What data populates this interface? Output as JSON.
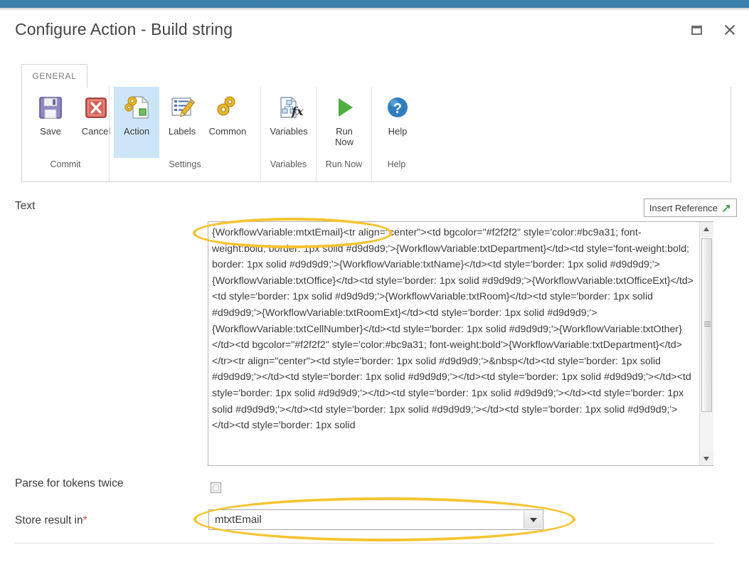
{
  "window": {
    "title": "Configure Action - Build string",
    "accent_color": "#3d7fac",
    "restore_icon": "restore-window-icon",
    "close_icon": "close-icon"
  },
  "ribbon": {
    "tabs": [
      {
        "label": "GENERAL",
        "active": true
      }
    ],
    "groups": [
      {
        "label": "Commit",
        "buttons": [
          {
            "label": "Save",
            "icon": "save-floppy-disk-icon",
            "selected": false
          },
          {
            "label": "Cancel",
            "icon": "cancel-red-x-icon",
            "selected": false
          }
        ]
      },
      {
        "label": "Settings",
        "buttons": [
          {
            "label": "Action",
            "icon": "action-gears-document-icon",
            "selected": true
          },
          {
            "label": "Labels",
            "icon": "labels-list-pencil-icon",
            "selected": false
          },
          {
            "label": "Common",
            "icon": "common-gears-icon",
            "selected": false
          }
        ]
      },
      {
        "label": "Variables",
        "buttons": [
          {
            "label": "Variables",
            "icon": "variables-fx-document-icon",
            "selected": false
          }
        ]
      },
      {
        "label": "Run Now",
        "buttons": [
          {
            "label": "Run\nNow",
            "icon": "run-now-green-play-icon",
            "selected": false
          }
        ]
      },
      {
        "label": "Help",
        "buttons": [
          {
            "label": "Help",
            "icon": "help-question-circle-icon",
            "selected": false
          }
        ]
      }
    ]
  },
  "form": {
    "text_field": {
      "label": "Text",
      "insert_reference_label": "Insert Reference",
      "insert_reference_icon": "insert-reference-arrow-icon",
      "value": "{WorkflowVariable:mtxtEmail}<tr align=\"center\"><td bgcolor=\"#f2f2f2\" style='color:#bc9a31; font-weight:bold; border: 1px solid #d9d9d9;'>{WorkflowVariable:txtDepartment}</td><td style='font-weight:bold; border: 1px solid #d9d9d9;'>{WorkflowVariable:txtName}</td><td style='border: 1px solid #d9d9d9;'>{WorkflowVariable:txtOffice}</td><td style='border: 1px solid #d9d9d9;'>{WorkflowVariable:txtOfficeExt}</td><td style='border: 1px solid #d9d9d9;'>{WorkflowVariable:txtRoom}</td><td style='border: 1px solid #d9d9d9;'>{WorkflowVariable:txtRoomExt}</td><td style='border: 1px solid #d9d9d9;'>{WorkflowVariable:txtCellNumber}</td><td style='border: 1px solid #d9d9d9;'>{WorkflowVariable:txtOther}</td><td bgcolor=\"#f2f2f2\" style='color:#bc9a31; font-weight:bold'>{WorkflowVariable:txtDepartment}</td></tr><tr align=\"center\"><td style='border: 1px solid #d9d9d9;'>&nbsp</td><td style='border: 1px solid #d9d9d9;'></td><td style='border: 1px solid #d9d9d9;'></td><td style='border: 1px solid #d9d9d9;'></td><td style='border: 1px solid #d9d9d9;'></td><td style='border: 1px solid #d9d9d9;'></td><td style='border: 1px solid #d9d9d9;'></td><td style='border: 1px solid #d9d9d9;'></td><td style='border: 1px solid #d9d9d9;'></td><td style='border: 1px solid"
    },
    "parse_twice": {
      "label": "Parse for tokens twice",
      "checked": false
    },
    "store_result": {
      "label": "Store result in",
      "required_marker": "*",
      "value": "mtxtEmail",
      "options": [
        "mtxtEmail"
      ]
    }
  },
  "annotations": {
    "highlight_color": "#f5c431",
    "shapes": [
      {
        "name": "text-first-line-highlight"
      },
      {
        "name": "store-result-highlight"
      }
    ]
  }
}
